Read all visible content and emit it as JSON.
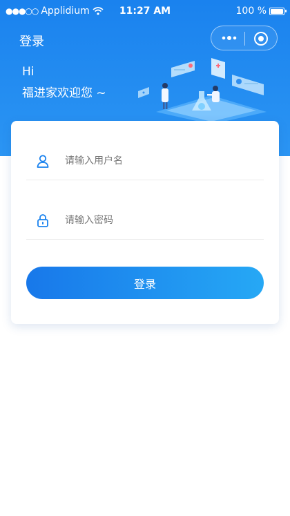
{
  "status_bar": {
    "carrier": "Applidium",
    "time": "11:27 AM",
    "battery": "100 %"
  },
  "nav": {
    "title": "登录"
  },
  "greeting": {
    "hi": "Hi",
    "welcome": "福进家欢迎您 ~"
  },
  "login_form": {
    "username_placeholder": "请输入用户名",
    "password_placeholder": "请输入密码",
    "submit_label": "登录"
  },
  "colors": {
    "header_blue": "#1a82ee",
    "button_start": "#1878ea",
    "button_end": "#26a8f5"
  },
  "icons": {
    "username": "user-icon",
    "password": "lock-icon",
    "capsule_more": "more-dots-icon",
    "capsule_close": "target-icon"
  }
}
